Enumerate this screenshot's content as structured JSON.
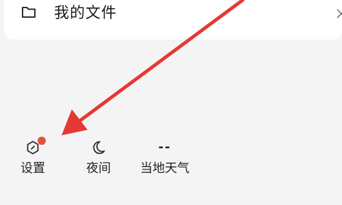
{
  "files": {
    "label": "我的文件",
    "icon": "folder-icon",
    "close_icon": "close-icon"
  },
  "quick_actions": [
    {
      "id": "settings",
      "label": "设置",
      "icon": "settings-hexagon-icon",
      "badge": true
    },
    {
      "id": "night",
      "label": "夜间",
      "icon": "moon-icon"
    },
    {
      "id": "weather",
      "label": "当地天气",
      "value": "--"
    }
  ],
  "colors": {
    "background": "#f4f4f4",
    "card": "#ffffff",
    "text": "#1a1a1a",
    "badge": "#e5533d",
    "annotation_arrow": "#e53935"
  }
}
